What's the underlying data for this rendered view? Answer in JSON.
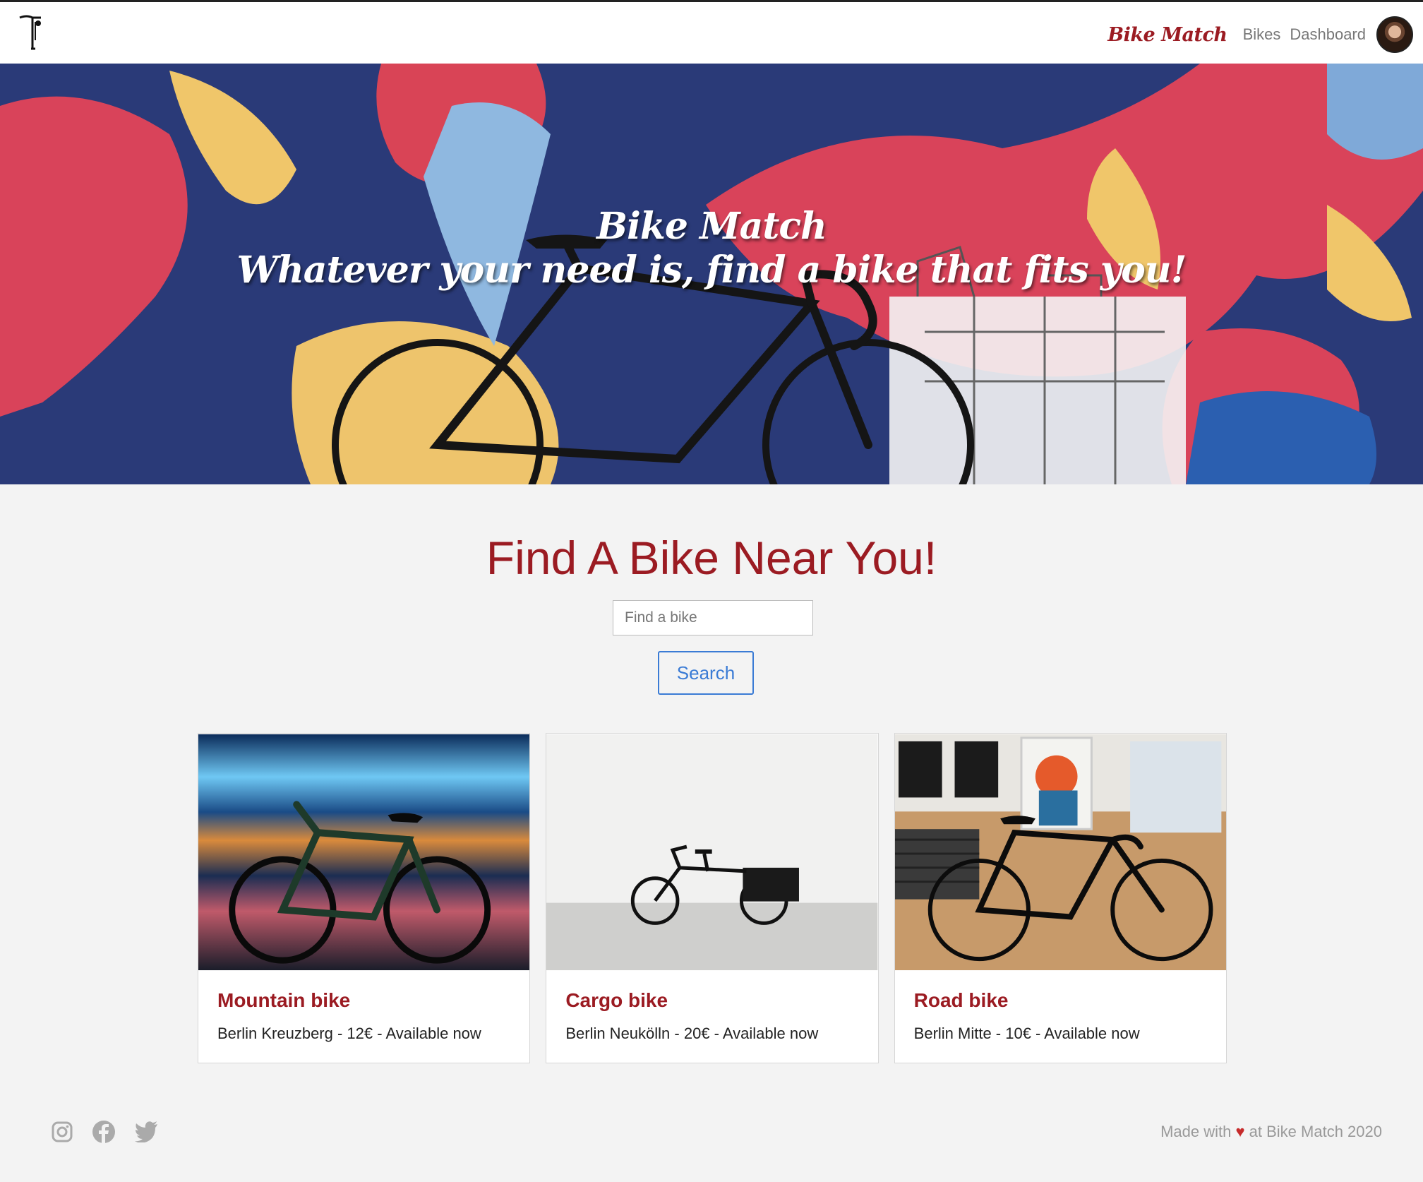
{
  "nav": {
    "brand": "Bike Match",
    "links": [
      "Bikes",
      "Dashboard"
    ],
    "logo_icon": "bicycle-logo-icon",
    "avatar_icon": "user-avatar"
  },
  "hero": {
    "title_line1": "Bike Match",
    "title_line2": "Whatever your need is, find a bike that fits you!"
  },
  "search": {
    "heading": "Find A Bike Near You!",
    "placeholder": "Find a bike",
    "button": "Search"
  },
  "bikes": [
    {
      "name": "Mountain bike",
      "details": "Berlin Kreuzberg - 12€ - Available now"
    },
    {
      "name": "Cargo bike",
      "details": "Berlin Neukölln - 20€ - Available now"
    },
    {
      "name": "Road bike",
      "details": "Berlin Mitte - 10€ - Available now"
    }
  ],
  "footer": {
    "icons": [
      "instagram-icon",
      "facebook-icon",
      "twitter-icon"
    ],
    "made_with": "Made with",
    "heart": "♥",
    "suffix": "at Bike Match 2020"
  },
  "colors": {
    "brand": "#9b1b22",
    "link_blue": "#3a7bd5",
    "background": "#f3f3f3"
  }
}
